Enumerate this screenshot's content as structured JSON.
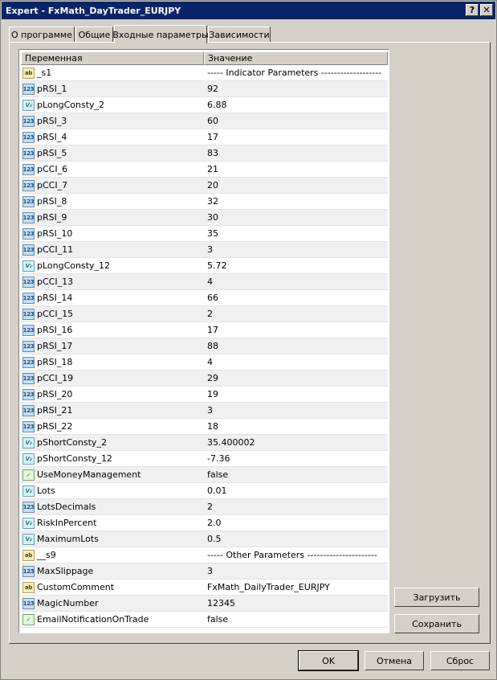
{
  "window": {
    "title": "Expert - FxMath_DayTrader_EURJPY",
    "help_glyph": "?",
    "close_glyph": "✕"
  },
  "tabs": [
    {
      "label": "О программе"
    },
    {
      "label": "Общие"
    },
    {
      "label": "Входные параметры",
      "active": true
    },
    {
      "label": "Зависимости"
    }
  ],
  "table": {
    "col_variable": "Переменная",
    "col_value": "Значение",
    "rows": [
      {
        "type": "str",
        "icon": "ab",
        "name": "_s1",
        "value": "-----  Indicator Parameters  -------------------"
      },
      {
        "type": "int",
        "icon": "123",
        "name": "pRSI_1",
        "value": "92"
      },
      {
        "type": "dbl",
        "icon": "V₂",
        "name": "pLongConsty_2",
        "value": "6.88"
      },
      {
        "type": "int",
        "icon": "123",
        "name": "pRSI_3",
        "value": "60"
      },
      {
        "type": "int",
        "icon": "123",
        "name": "pRSI_4",
        "value": "17"
      },
      {
        "type": "int",
        "icon": "123",
        "name": "pRSI_5",
        "value": "83"
      },
      {
        "type": "int",
        "icon": "123",
        "name": "pCCI_6",
        "value": "21"
      },
      {
        "type": "int",
        "icon": "123",
        "name": "pCCI_7",
        "value": "20"
      },
      {
        "type": "int",
        "icon": "123",
        "name": "pRSI_8",
        "value": "32"
      },
      {
        "type": "int",
        "icon": "123",
        "name": "pRSI_9",
        "value": "30"
      },
      {
        "type": "int",
        "icon": "123",
        "name": "pRSI_10",
        "value": "35"
      },
      {
        "type": "int",
        "icon": "123",
        "name": "pCCI_11",
        "value": "3"
      },
      {
        "type": "dbl",
        "icon": "V₂",
        "name": "pLongConsty_12",
        "value": "5.72"
      },
      {
        "type": "int",
        "icon": "123",
        "name": "pCCI_13",
        "value": "4"
      },
      {
        "type": "int",
        "icon": "123",
        "name": "pRSI_14",
        "value": "66"
      },
      {
        "type": "int",
        "icon": "123",
        "name": "pCCI_15",
        "value": "2"
      },
      {
        "type": "int",
        "icon": "123",
        "name": "pRSI_16",
        "value": "17"
      },
      {
        "type": "int",
        "icon": "123",
        "name": "pRSI_17",
        "value": "88"
      },
      {
        "type": "int",
        "icon": "123",
        "name": "pRSI_18",
        "value": "4"
      },
      {
        "type": "int",
        "icon": "123",
        "name": "pCCI_19",
        "value": "29"
      },
      {
        "type": "int",
        "icon": "123",
        "name": "pRSI_20",
        "value": "19"
      },
      {
        "type": "int",
        "icon": "123",
        "name": "pRSI_21",
        "value": "3"
      },
      {
        "type": "int",
        "icon": "123",
        "name": "pRSI_22",
        "value": "18"
      },
      {
        "type": "dbl",
        "icon": "V₂",
        "name": "pShortConsty_2",
        "value": "35.400002"
      },
      {
        "type": "dbl",
        "icon": "V₂",
        "name": "pShortConsty_12",
        "value": "-7.36"
      },
      {
        "type": "bool",
        "icon": "✓",
        "name": "UseMoneyManagement",
        "value": "false"
      },
      {
        "type": "dbl",
        "icon": "V₂",
        "name": "Lots",
        "value": "0.01"
      },
      {
        "type": "int",
        "icon": "123",
        "name": "LotsDecimals",
        "value": "2"
      },
      {
        "type": "dbl",
        "icon": "V₂",
        "name": "RiskInPercent",
        "value": "2.0"
      },
      {
        "type": "dbl",
        "icon": "V₂",
        "name": "MaximumLots",
        "value": "0.5"
      },
      {
        "type": "str",
        "icon": "ab",
        "name": "__s9",
        "value": "-----  Other Parameters  ----------------------"
      },
      {
        "type": "int",
        "icon": "123",
        "name": "MaxSlippage",
        "value": "3"
      },
      {
        "type": "str",
        "icon": "ab",
        "name": "CustomComment",
        "value": "FxMath_DailyTrader_EURJPY"
      },
      {
        "type": "int",
        "icon": "123",
        "name": "MagicNumber",
        "value": "12345"
      },
      {
        "type": "bool",
        "icon": "✓",
        "name": "EmailNotificationOnTrade",
        "value": "false"
      }
    ]
  },
  "side_buttons": {
    "load": "Загрузить",
    "save": "Сохранить"
  },
  "footer_buttons": {
    "ok": "OK",
    "cancel": "Отмена",
    "reset": "Сброс"
  }
}
